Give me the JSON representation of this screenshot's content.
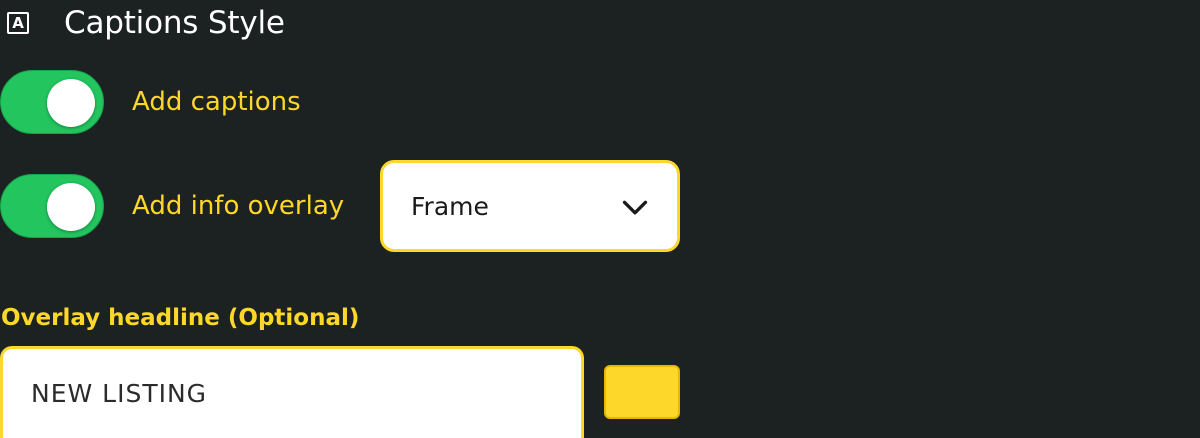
{
  "header": {
    "icon": "captions-icon",
    "icon_glyph": "A",
    "title": "Captions Style"
  },
  "captions_toggle": {
    "label": "Add captions",
    "checked": true
  },
  "overlay_toggle": {
    "label": "Add info overlay",
    "checked": true
  },
  "overlay_style_select": {
    "value": "Frame",
    "icon": "chevron-down-icon"
  },
  "overlay_headline": {
    "label": "Overlay headline (Optional)",
    "value": "NEW LISTING"
  },
  "headline_color": {
    "value": "#fdd72a"
  },
  "colors": {
    "background": "#1c2121",
    "accent": "#fdd72a",
    "toggle_on": "#22c55e"
  }
}
